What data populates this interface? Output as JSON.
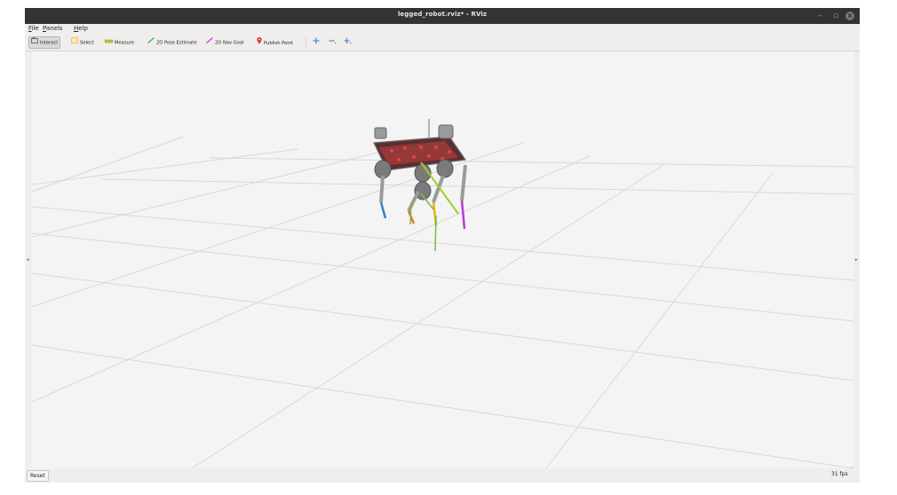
{
  "window": {
    "title": "legged_robot.rviz* - RViz"
  },
  "menu": [
    {
      "prefix": "",
      "mnemonic": "F",
      "rest": "ile"
    },
    {
      "prefix": "",
      "mnemonic": "P",
      "rest": "anels"
    },
    {
      "prefix": "",
      "mnemonic": "H",
      "rest": "elp"
    }
  ],
  "toolbar": {
    "interact": "Interact",
    "select": "Select",
    "measure": "Measure",
    "pose_estimate": "2D Pose Estimate",
    "nav_goal": "2D Nav Goal",
    "publish_point": "Publish Point",
    "active_tool": "Interact"
  },
  "status": {
    "reset": "Reset",
    "fps": "31 fps"
  },
  "colors": {
    "pose_estimate_icon": "#3cb043",
    "nav_goal_icon": "#c43cd6",
    "publish_point_icon": "#d9322b",
    "camera_tool_icon": "#3a7bd5"
  }
}
